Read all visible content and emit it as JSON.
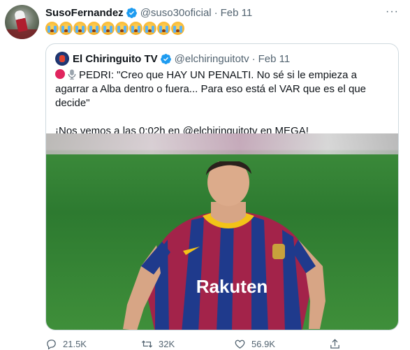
{
  "tweet": {
    "author_name": "SusoFernandez",
    "author_handle": "@suso30oficial",
    "separator": "·",
    "date": "Feb 11",
    "more": "···",
    "emoji_count": 10
  },
  "quoted": {
    "author_name": "El Chiringuito TV",
    "author_handle": "@elchiringuitotv",
    "separator": "·",
    "date": "Feb 11",
    "line1": "PEDRI: \"Creo que HAY UN PENALTI. No sé si le empieza a agarrar a Alba dentro o fuera... Para eso está el VAR que es el que decide\"",
    "line2": "¡Nos vemos a las 0:02h en @elchiringuitotv en MEGA!",
    "photo_shirt_text": "Rakuten"
  },
  "actions": {
    "replies": "21.5K",
    "retweets": "32K",
    "likes": "56.9K"
  },
  "colors": {
    "verified": "#1d9bf0",
    "muted": "#536471",
    "border": "#cfd9de"
  },
  "icons": [
    "verified-icon",
    "more-icon",
    "loudly-crying-face-icon",
    "red-circle-icon",
    "microphone-icon",
    "reply-icon",
    "retweet-icon",
    "like-icon",
    "share-icon"
  ]
}
